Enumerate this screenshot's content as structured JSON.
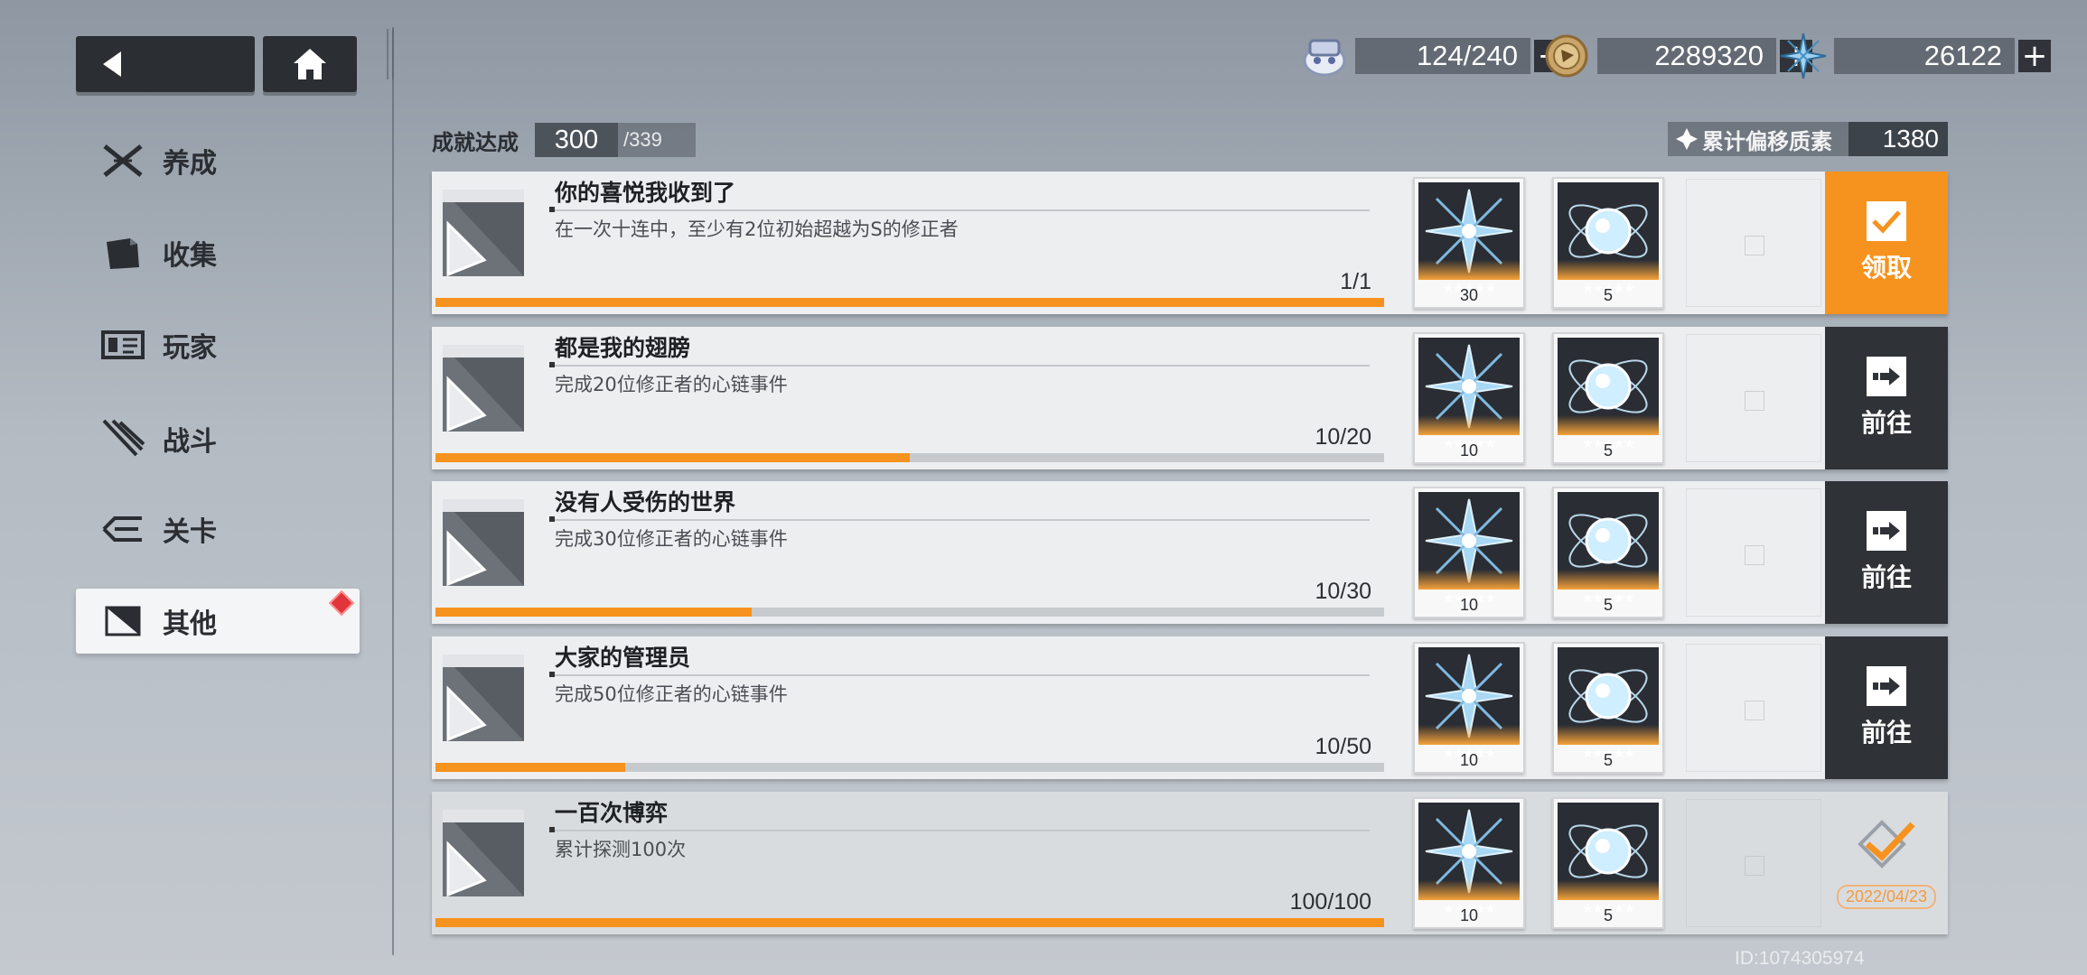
{
  "nav": {
    "back_icon": "back-arrow-icon",
    "home_icon": "home-icon"
  },
  "sidebar": {
    "items": [
      {
        "label": "养成",
        "icon": "crossed-swords-icon",
        "active": false
      },
      {
        "label": "收集",
        "icon": "folder-icon",
        "active": false
      },
      {
        "label": "玩家",
        "icon": "id-card-icon",
        "active": false
      },
      {
        "label": "战斗",
        "icon": "blades-icon",
        "active": false
      },
      {
        "label": "关卡",
        "icon": "stage-icon",
        "active": false
      },
      {
        "label": "其他",
        "icon": "half-square-icon",
        "active": true,
        "badge": "red-diamond"
      }
    ]
  },
  "resources": [
    {
      "icon": "stamina-icon",
      "value": "124/240"
    },
    {
      "icon": "coin-icon",
      "value": "2289320"
    },
    {
      "icon": "crystal-icon",
      "value": "26122"
    }
  ],
  "summary": {
    "achievements_label": "成就达成",
    "achieved": "300",
    "total": "/339",
    "mass_label": "累计偏移质素",
    "mass_value": "1380"
  },
  "achievements": [
    {
      "title": "你的喜悦我收到了",
      "desc": "在一次十连中，至少有2位初始超越为S的修正者",
      "progress": "1/1",
      "fraction": 1.0,
      "rewards": [
        {
          "icon": "star-crystal-icon",
          "stars": "★★★★★",
          "qty": "30"
        },
        {
          "icon": "orb-icon",
          "stars": "★★★★★",
          "qty": "5"
        }
      ],
      "action": {
        "type": "claim",
        "label": "领取"
      }
    },
    {
      "title": "都是我的翅膀",
      "desc": "完成20位修正者的心链事件",
      "progress": "10/20",
      "fraction": 0.5,
      "rewards": [
        {
          "icon": "star-crystal-icon",
          "stars": "★★★★★",
          "qty": "10"
        },
        {
          "icon": "orb-icon",
          "stars": "★★★★★",
          "qty": "5"
        }
      ],
      "action": {
        "type": "go",
        "label": "前往"
      }
    },
    {
      "title": "没有人受伤的世界",
      "desc": "完成30位修正者的心链事件",
      "progress": "10/30",
      "fraction": 0.333,
      "rewards": [
        {
          "icon": "star-crystal-icon",
          "stars": "★★★★★",
          "qty": "10"
        },
        {
          "icon": "orb-icon",
          "stars": "★★★★★",
          "qty": "5"
        }
      ],
      "action": {
        "type": "go",
        "label": "前往"
      }
    },
    {
      "title": "大家的管理员",
      "desc": "完成50位修正者的心链事件",
      "progress": "10/50",
      "fraction": 0.2,
      "rewards": [
        {
          "icon": "star-crystal-icon",
          "stars": "★★★★★",
          "qty": "10"
        },
        {
          "icon": "orb-icon",
          "stars": "★★★★★",
          "qty": "5"
        }
      ],
      "action": {
        "type": "go",
        "label": "前往"
      }
    },
    {
      "title": "一百次博弈",
      "desc": "累计探测100次",
      "progress": "100/100",
      "fraction": 1.0,
      "rewards": [
        {
          "icon": "star-crystal-icon",
          "stars": "★★★★★",
          "qty": "10"
        },
        {
          "icon": "orb-icon",
          "stars": "★★★★★",
          "qty": "5"
        }
      ],
      "action": {
        "type": "done",
        "label": "2022/04/23"
      }
    }
  ],
  "uid": "ID:1074305974",
  "colors": {
    "accent": "#f6921e",
    "dark": "#2f3237",
    "badge": "#e0353b"
  }
}
